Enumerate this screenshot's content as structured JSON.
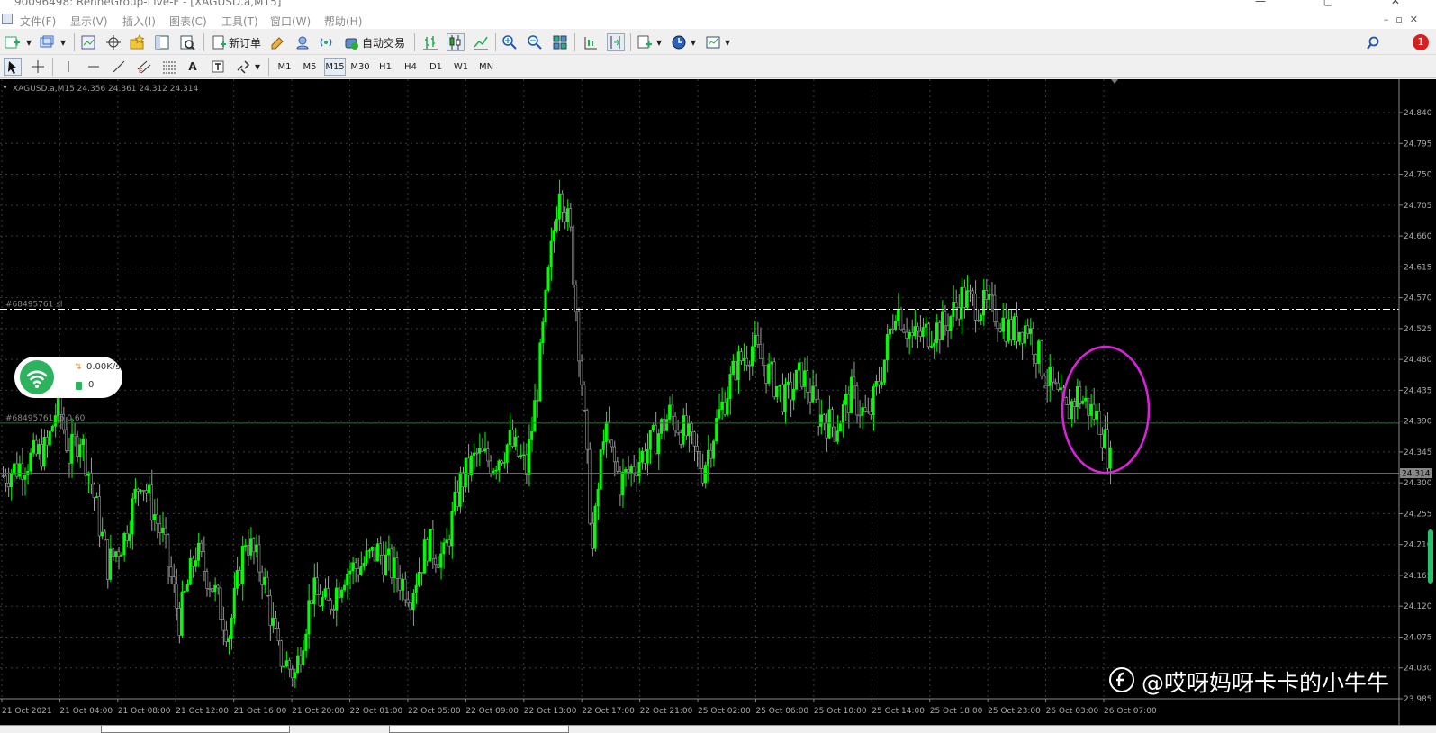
{
  "window": {
    "title": "90096498: RenneGroup-Live-F - [XAGUSD.a,M15]"
  },
  "menu": [
    "文件(F)",
    "显示(V)",
    "插入(I)",
    "图表(C)",
    "工具(T)",
    "窗口(W)",
    "帮助(H)"
  ],
  "toolbar": {
    "new_order_label": "新订单",
    "auto_trade_label": "自动交易",
    "notification_count": "1"
  },
  "timeframes": [
    "M1",
    "M5",
    "M15",
    "M30",
    "H1",
    "H4",
    "D1",
    "W1",
    "MN"
  ],
  "active_timeframe": "M15",
  "chart": {
    "symbol_info": "XAGUSD.a,M15  24.356 24.361 24.312 24.314",
    "current_price": "24.314",
    "order_line_sl": "#68495761 sl",
    "order_line_tp": "#68495761 tp 0.60",
    "watermark": "@哎呀妈呀卡卡的小牛牛"
  },
  "network_widget": {
    "speed": "0.00K/s",
    "count": "0"
  },
  "chart_data": {
    "type": "candlestick",
    "symbol": "XAGUSD.a",
    "timeframe": "M15",
    "ohlc_last": {
      "open": 24.356,
      "high": 24.361,
      "low": 24.312,
      "close": 24.314
    },
    "ylim": [
      23.985,
      24.865
    ],
    "y_ticks": [
      "24.840",
      "24.795",
      "24.750",
      "24.705",
      "24.660",
      "24.615",
      "24.570",
      "24.525",
      "24.480",
      "24.435",
      "24.390",
      "24.345",
      "24.300",
      "24.255",
      "24.210",
      "24.165",
      "24.120",
      "24.075",
      "24.030",
      "23.985"
    ],
    "x_ticks": [
      "21 Oct 2021",
      "21 Oct 04:00",
      "21 Oct 08:00",
      "21 Oct 12:00",
      "21 Oct 16:00",
      "21 Oct 20:00",
      "22 Oct 01:00",
      "22 Oct 05:00",
      "22 Oct 09:00",
      "22 Oct 13:00",
      "22 Oct 17:00",
      "22 Oct 21:00",
      "25 Oct 02:00",
      "25 Oct 06:00",
      "25 Oct 10:00",
      "25 Oct 14:00",
      "25 Oct 18:00",
      "25 Oct 23:00",
      "26 Oct 03:00",
      "26 Oct 07:00"
    ],
    "bull_color": "#00ff00",
    "bear_color": "#a0a0a0",
    "sl_level": 24.553,
    "tp_level": 24.387,
    "current_level": 24.314,
    "close_path": [
      [
        0,
        24.31
      ],
      [
        4,
        24.33
      ],
      [
        8,
        24.35
      ],
      [
        10,
        24.42
      ],
      [
        12,
        24.34
      ],
      [
        14,
        24.37
      ],
      [
        16,
        24.3
      ],
      [
        19,
        24.18
      ],
      [
        22,
        24.22
      ],
      [
        25,
        24.31
      ],
      [
        29,
        24.22
      ],
      [
        32,
        24.1
      ],
      [
        35,
        24.2
      ],
      [
        38,
        24.15
      ],
      [
        41,
        24.08
      ],
      [
        44,
        24.22
      ],
      [
        47,
        24.17
      ],
      [
        50,
        24.05
      ],
      [
        53,
        24.02
      ],
      [
        56,
        24.14
      ],
      [
        59,
        24.12
      ],
      [
        62,
        24.17
      ],
      [
        65,
        24.18
      ],
      [
        68,
        24.2
      ],
      [
        71,
        24.17
      ],
      [
        74,
        24.14
      ],
      [
        77,
        24.21
      ],
      [
        80,
        24.19
      ],
      [
        83,
        24.3
      ],
      [
        86,
        24.34
      ],
      [
        89,
        24.33
      ],
      [
        92,
        24.36
      ],
      [
        95,
        24.32
      ],
      [
        97,
        24.44
      ],
      [
        99,
        24.6
      ],
      [
        101,
        24.74
      ],
      [
        103,
        24.66
      ],
      [
        105,
        24.45
      ],
      [
        107,
        24.2
      ],
      [
        109,
        24.38
      ],
      [
        112,
        24.3
      ],
      [
        115,
        24.33
      ],
      [
        118,
        24.36
      ],
      [
        121,
        24.4
      ],
      [
        124,
        24.37
      ],
      [
        127,
        24.32
      ],
      [
        130,
        24.4
      ],
      [
        133,
        24.47
      ],
      [
        136,
        24.5
      ],
      [
        139,
        24.46
      ],
      [
        142,
        24.42
      ],
      [
        145,
        24.46
      ],
      [
        148,
        24.4
      ],
      [
        151,
        24.38
      ],
      [
        154,
        24.43
      ],
      [
        157,
        24.39
      ],
      [
        160,
        24.48
      ],
      [
        162,
        24.56
      ],
      [
        165,
        24.51
      ],
      [
        168,
        24.52
      ],
      [
        171,
        24.53
      ],
      [
        174,
        24.57
      ],
      [
        177,
        24.56
      ],
      [
        180,
        24.55
      ],
      [
        183,
        24.52
      ],
      [
        186,
        24.53
      ],
      [
        189,
        24.46
      ],
      [
        191,
        24.43
      ],
      [
        193,
        24.4
      ],
      [
        195,
        24.43
      ],
      [
        197,
        24.41
      ],
      [
        199,
        24.39
      ],
      [
        201,
        24.33
      ]
    ]
  }
}
